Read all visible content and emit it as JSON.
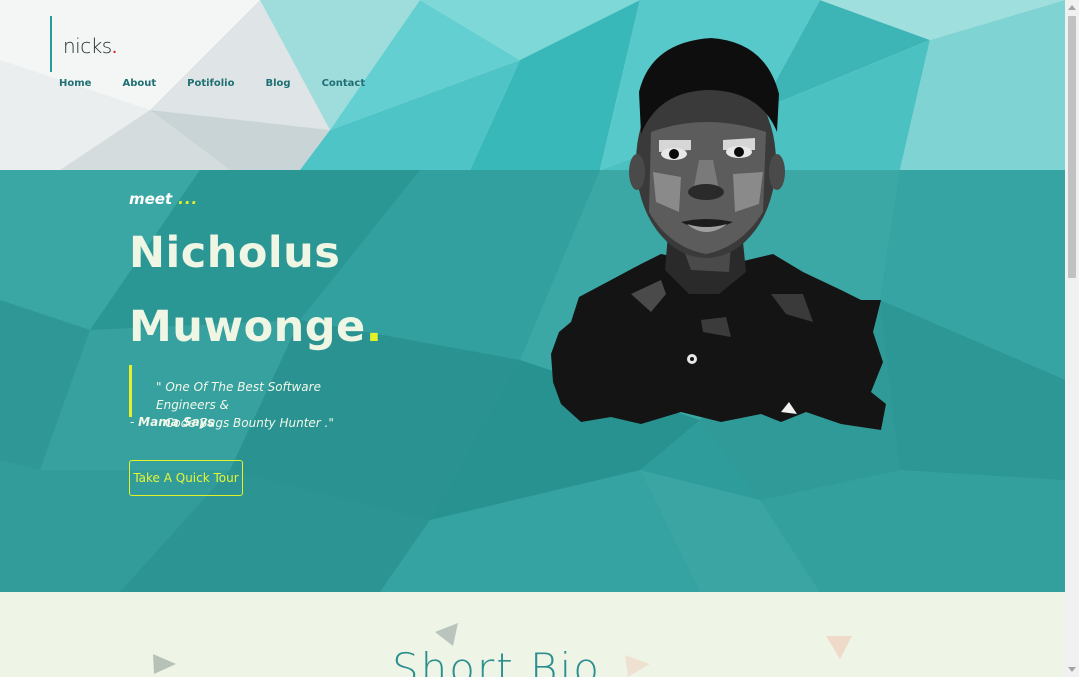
{
  "brand": {
    "name": "nicks",
    "dot": "."
  },
  "nav": [
    {
      "label": "Home"
    },
    {
      "label": "About"
    },
    {
      "label": "Potifolio"
    },
    {
      "label": "Blog"
    },
    {
      "label": "Contact"
    }
  ],
  "hero": {
    "meet": "meet",
    "meet_dots": "...",
    "first_name": "Nicholus",
    "last_name": "Muwonge",
    "name_dot": ".",
    "quote_line1": "\" One Of The Best Software Engineers &",
    "quote_line2": "Code Bugs Bounty Hunter .\"",
    "attribution_prefix": "- ",
    "attribution": "Mama Says",
    "cta_label": "Take A Quick Tour"
  },
  "section": {
    "title": "Short Bio"
  },
  "colors": {
    "teal": "#2a9a98",
    "accent_yellow": "#e3f02a",
    "brand_red": "#d4202a",
    "light_bg": "#eef5e6"
  }
}
